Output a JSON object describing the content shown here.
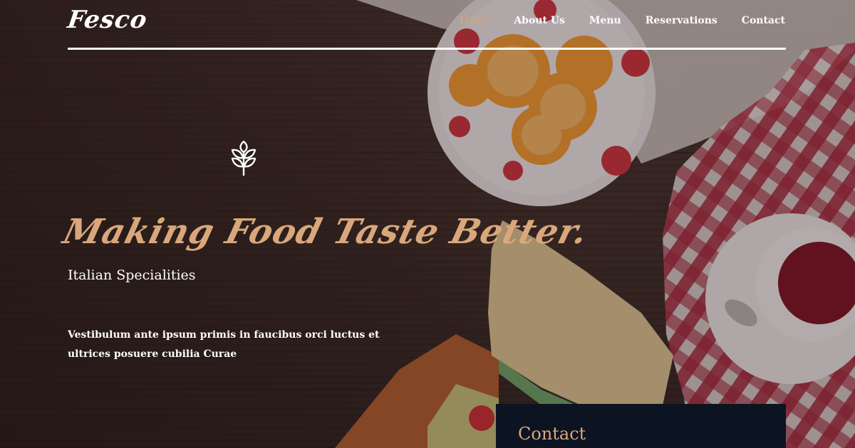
{
  "brand": {
    "logo_text": "Fesco"
  },
  "nav": {
    "items": [
      {
        "label": "Home",
        "active": true
      },
      {
        "label": "About Us",
        "active": false
      },
      {
        "label": "Menu",
        "active": false
      },
      {
        "label": "Reservations",
        "active": false
      },
      {
        "label": "Contact",
        "active": false
      }
    ]
  },
  "hero": {
    "icon": "wheat-icon",
    "title": "Making Food Taste Better.",
    "subtitle": "Italian Specialities",
    "description": "Vestibulum ante ipsum primis in faucibus orci luctus et ultrices posuere cubilia Curae"
  },
  "contact_panel": {
    "title": "Contact"
  },
  "colors": {
    "accent": "#d9a77b",
    "nav_active": "#d7a57a",
    "panel_bg": "#0c1321",
    "wood_dark": "#3c2b27"
  }
}
